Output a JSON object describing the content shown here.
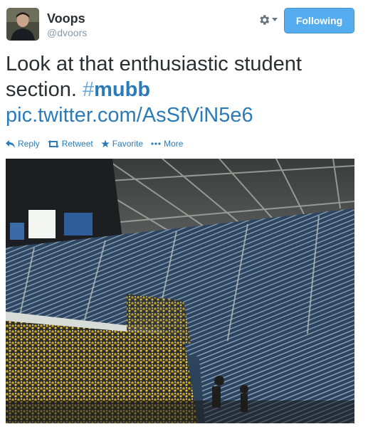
{
  "user": {
    "display_name": "Voops",
    "handle": "@dvoors",
    "avatar_icon": "user-avatar-photo"
  },
  "follow_button": {
    "label": "Following",
    "color": "#55acee"
  },
  "tweet": {
    "text_main": "Look at that enthusiastic student section. ",
    "hashtag_symbol": "#",
    "hashtag": "mubb",
    "pic_link": "pic.twitter.com/AsSfViN5e6",
    "link_color": "#2b7bb9"
  },
  "actions": [
    {
      "label": "Reply",
      "icon": "reply-icon"
    },
    {
      "label": "Retweet",
      "icon": "retweet-icon"
    },
    {
      "label": "Favorite",
      "icon": "star-icon"
    },
    {
      "label": "More",
      "icon": "more-dots-icon"
    }
  ],
  "photo": {
    "subject": "arena-photo",
    "icon": "image"
  }
}
